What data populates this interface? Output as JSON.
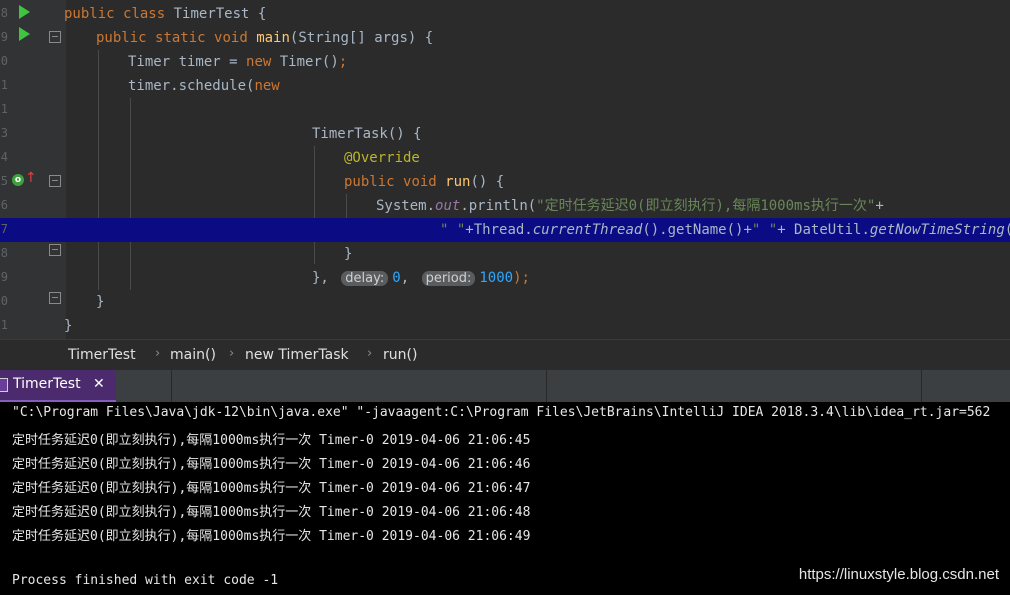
{
  "editor": {
    "line_numbers": [
      "8",
      "9",
      "0",
      "1",
      "1",
      "3",
      "4",
      "5",
      "6",
      "7",
      "8",
      "9",
      "0",
      "1"
    ],
    "class_decl": {
      "kw1": "public",
      "kw2": "class",
      "name": "TimerTest",
      "brace": " {"
    },
    "main_decl": {
      "kw1": "public",
      "kw2": "static",
      "kw3": "void",
      "name": "main",
      "params": "(String[] args)",
      "brace": " {"
    },
    "timer_decl": {
      "pre": "Timer timer = ",
      "kw": "new",
      "post": " Timer()",
      "semi": ";"
    },
    "schedule_call": {
      "pre": "timer.schedule(",
      "kw": "new"
    },
    "task_decl": "TimerTask() {",
    "annotation": "@Override",
    "run_decl": {
      "kw1": "public",
      "kw2": "void",
      "name": "run",
      "post": "() {"
    },
    "println": {
      "pre": "System.",
      "field": "out",
      "mid": ".println(",
      "str": "\"定时任务延迟0(即立刻执行),每隔1000ms执行一次\"",
      "post": "+"
    },
    "thread_line": {
      "str1": "\" \"",
      "p1": "+Thread.",
      "m1": "currentThread",
      "p2": "().getName()+",
      "str2": "\" \"",
      "p3": "+ DateUtil.",
      "m2": "getNowTimeString",
      "p4": "());"
    },
    "close_brace": "}",
    "schedule_end": {
      "pre": "},",
      "hint1": "delay:",
      "v1": "0",
      "comma": ",",
      "hint2": "period:",
      "v2": "1000",
      "post": ");"
    },
    "close_main": "}",
    "close_class": "}"
  },
  "breadcrumb": [
    "TimerTest",
    "main()",
    "new TimerTask",
    "run()"
  ],
  "breadcrumb_sep": "›",
  "run_tab": {
    "label": "TimerTest",
    "close": "✕"
  },
  "console": {
    "command": "\"C:\\Program Files\\Java\\jdk-12\\bin\\java.exe\" \"-javaagent:C:\\Program Files\\JetBrains\\IntelliJ IDEA 2018.3.4\\lib\\idea_rt.jar=562",
    "output": [
      "定时任务延迟0(即立刻执行),每隔1000ms执行一次 Timer-0 2019-04-06 21:06:45",
      "定时任务延迟0(即立刻执行),每隔1000ms执行一次 Timer-0 2019-04-06 21:06:46",
      "定时任务延迟0(即立刻执行),每隔1000ms执行一次 Timer-0 2019-04-06 21:06:47",
      "定时任务延迟0(即立刻执行),每隔1000ms执行一次 Timer-0 2019-04-06 21:06:48",
      "定时任务延迟0(即立刻执行),每隔1000ms执行一次 Timer-0 2019-04-06 21:06:49"
    ],
    "exit": "Process finished with exit code -1"
  },
  "watermark": "https://linuxstyle.blog.csdn.net",
  "icons": {
    "run": "run-icon",
    "override": "override-icon",
    "fold": "fold-icon",
    "close": "close-icon",
    "console": "console-icon"
  },
  "colors": {
    "highlight_line": "#0b0b84",
    "run_tab": "#4c2a6e",
    "keyword": "#cc7832",
    "string": "#6a8759",
    "method": "#ffc66d"
  }
}
